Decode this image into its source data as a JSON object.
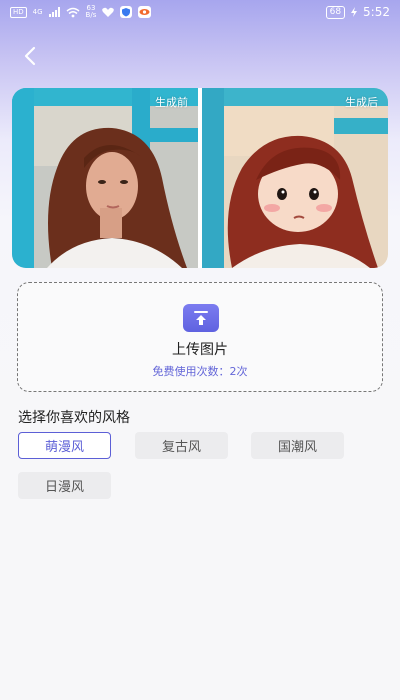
{
  "status_bar": {
    "net_tag": "HD",
    "net_gen": "4G",
    "speed_value": "63",
    "speed_unit": "B/s",
    "battery": "68",
    "time": "5:52"
  },
  "header": {
    "back_icon": "chevron-left-icon"
  },
  "compare": {
    "before_label": "生成前",
    "after_label": "生成后"
  },
  "upload": {
    "icon": "upload-icon",
    "title": "上传图片",
    "free_uses": "免费使用次数：2次"
  },
  "styles": {
    "section_title": "选择你喜欢的风格",
    "options": [
      {
        "label": "萌漫风",
        "selected": true
      },
      {
        "label": "复古风",
        "selected": false
      },
      {
        "label": "国潮风",
        "selected": false
      },
      {
        "label": "日漫风",
        "selected": false
      }
    ]
  },
  "colors": {
    "accent": "#5c5fd6",
    "header_gradient_top": "#a7a6ee"
  }
}
